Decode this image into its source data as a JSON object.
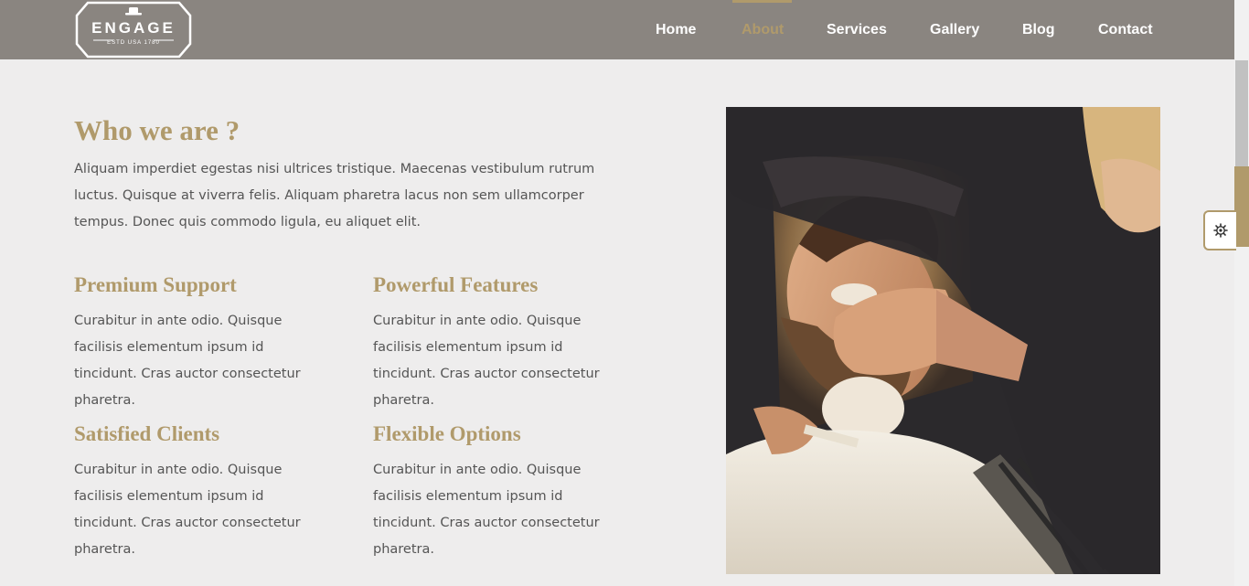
{
  "brand": {
    "name": "ENGAGE",
    "tagline": "ESTD USA 1780"
  },
  "nav": {
    "items": [
      {
        "label": "Home",
        "active": false
      },
      {
        "label": "About",
        "active": true
      },
      {
        "label": "Services",
        "active": false
      },
      {
        "label": "Gallery",
        "active": false
      },
      {
        "label": "Blog",
        "active": false
      },
      {
        "label": "Contact",
        "active": false
      }
    ]
  },
  "about": {
    "title": "Who we are ?",
    "intro": "Aliquam imperdiet egestas nisi ultrices tristique. Maecenas vestibulum rutrum luctus. Quisque at viverra felis. Aliquam pharetra lacus non sem ullamcorper tempus. Donec quis commodo ligula, eu aliquet elit."
  },
  "features": [
    {
      "title": "Premium Support",
      "text": "Curabitur in ante odio. Quisque facilisis elementum ipsum id tincidunt. Cras auctor consectetur pharetra."
    },
    {
      "title": "Powerful Features",
      "text": "Curabitur in ante odio. Quisque facilisis elementum ipsum id tincidunt. Cras auctor consectetur pharetra."
    },
    {
      "title": "Satisfied Clients",
      "text": "Curabitur in ante odio. Quisque facilisis elementum ipsum id tincidunt. Cras auctor consectetur pharetra."
    },
    {
      "title": "Flexible Options",
      "text": "Curabitur in ante odio. Quisque facilisis elementum ipsum id tincidunt. Cras auctor consectetur pharetra."
    }
  ],
  "theme": {
    "accent": "#b09a6b",
    "navbar_bg": "#8a8580",
    "page_bg": "#eeeded",
    "text": "#555555"
  },
  "icons": {
    "settings": "gear-icon",
    "logo_hat": "hat-icon"
  }
}
